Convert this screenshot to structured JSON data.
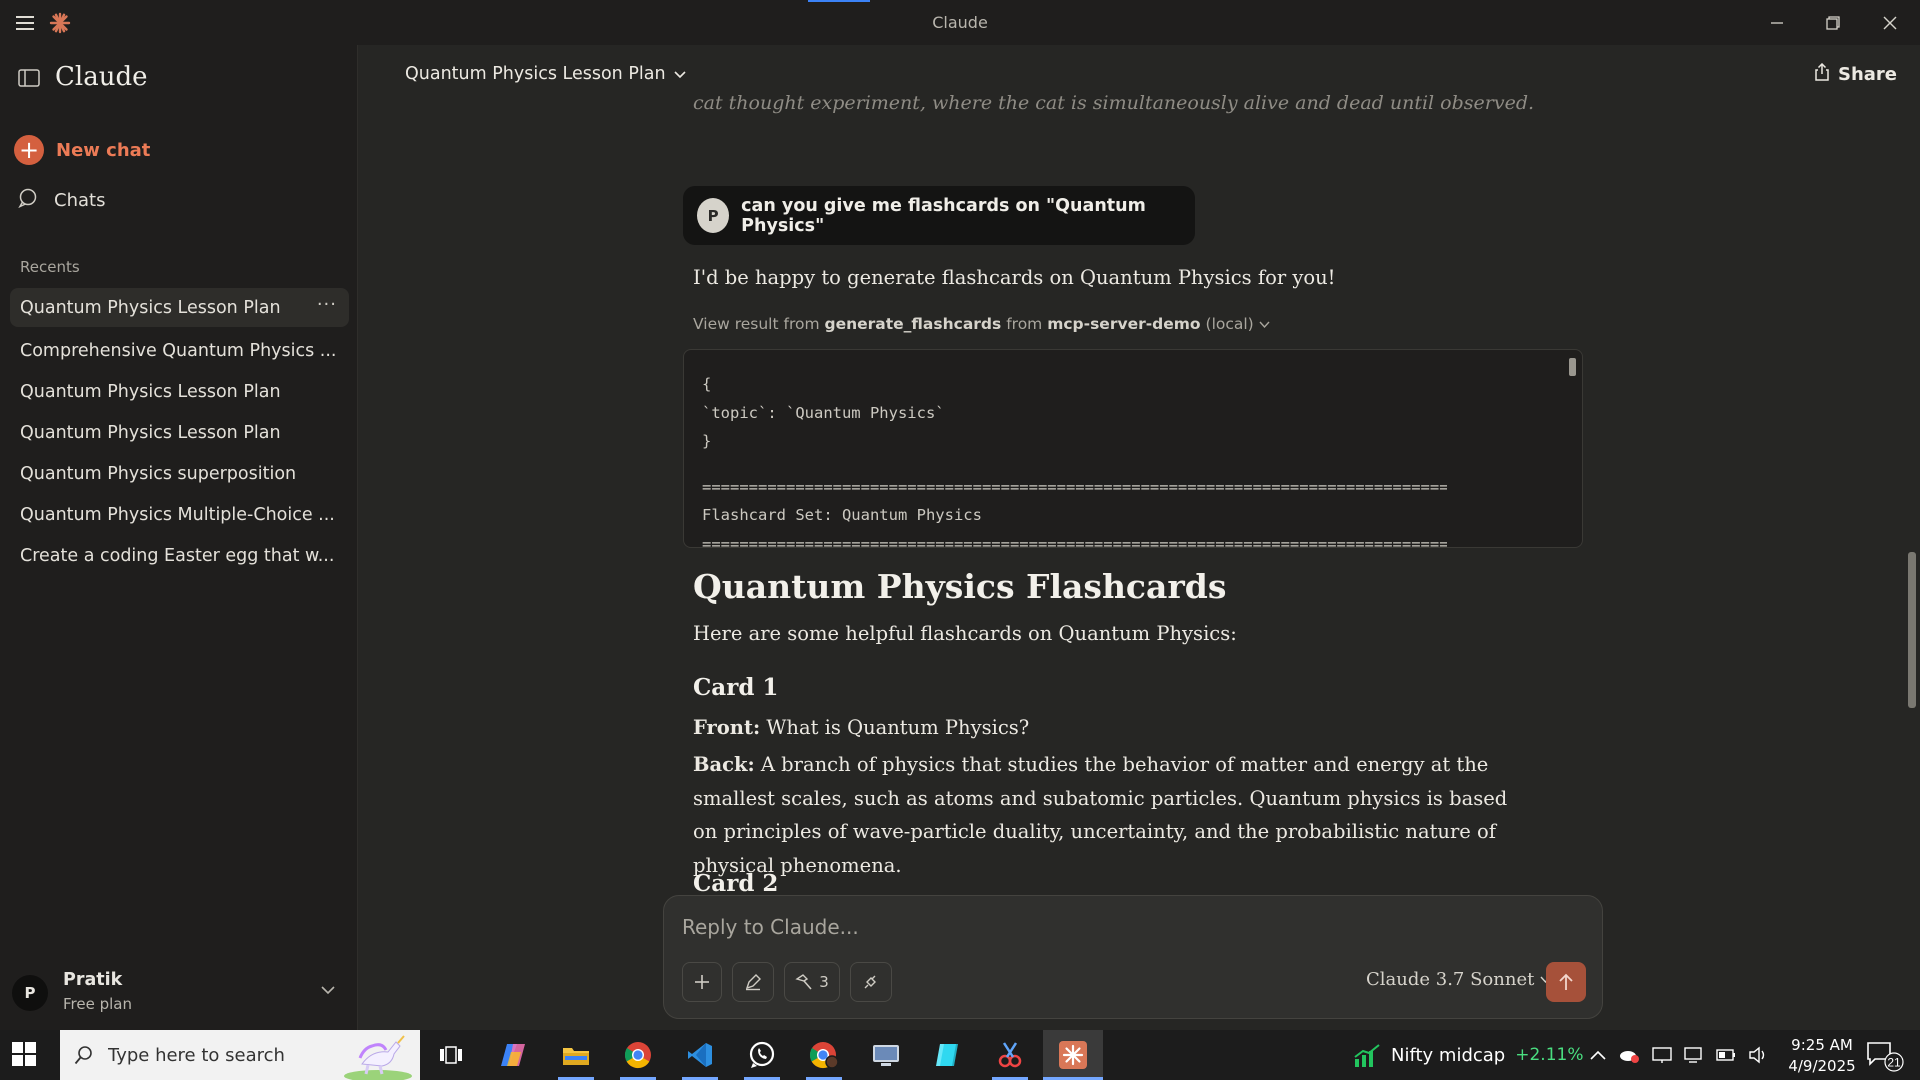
{
  "window": {
    "title": "Claude"
  },
  "sidebar": {
    "brand": "Claude",
    "new_chat": "New chat",
    "chats": "Chats",
    "recents_label": "Recents",
    "recents": [
      "Quantum Physics Lesson Plan",
      "Comprehensive Quantum Physics ...",
      "Quantum Physics Lesson Plan",
      "Quantum Physics Lesson Plan",
      "Quantum Physics superposition",
      "Quantum Physics Multiple-Choice ...",
      "Create a coding Easter egg that w..."
    ],
    "user": {
      "initial": "P",
      "name": "Pratik",
      "plan": "Free plan"
    }
  },
  "header": {
    "chat_title": "Quantum Physics Lesson Plan",
    "share": "Share"
  },
  "conversation": {
    "faded_text": "cat thought experiment, where the cat is simultaneously alive and dead until observed.",
    "user_message": {
      "initial": "P",
      "text": "can you give me flashcards on \"Quantum Physics\""
    },
    "intro": "I'd be happy to generate flashcards on Quantum Physics for you!",
    "tool": {
      "prefix": "View result from",
      "tool_name": "generate_flashcards",
      "middle": "from",
      "server": "mcp-server-demo",
      "suffix": "(local)"
    },
    "code_lines": [
      "{",
      "  `topic`: `Quantum Physics`",
      "}",
      "",
      "================================================================================",
      "Flashcard Set: Quantum Physics",
      "================================================================================"
    ],
    "heading": "Quantum Physics Flashcards",
    "subintro": "Here are some helpful flashcards on Quantum Physics:",
    "card1": {
      "title": "Card 1",
      "front_label": "Front:",
      "front": "What is Quantum Physics?",
      "back_label": "Back:",
      "back": "A branch of physics that studies the behavior of matter and energy at the smallest scales, such as atoms and subatomic particles. Quantum physics is based on principles of wave-particle duality, uncertainty, and the probabilistic nature of physical phenomena."
    },
    "card2": {
      "title": "Card 2"
    }
  },
  "composer": {
    "placeholder": "Reply to Claude...",
    "tools_count": "3",
    "model": "Claude 3.7 Sonnet"
  },
  "taskbar": {
    "search_placeholder": "Type here to search",
    "stock_name": "Nifty midcap",
    "stock_change": "+2.11%",
    "time": "9:25 AM",
    "date": "4/9/2025",
    "notifications": "21"
  },
  "colors": {
    "accent": "#d4603f",
    "background": "#262624",
    "sidebar": "#1f1e1d",
    "stock_up": "#4ade80"
  }
}
